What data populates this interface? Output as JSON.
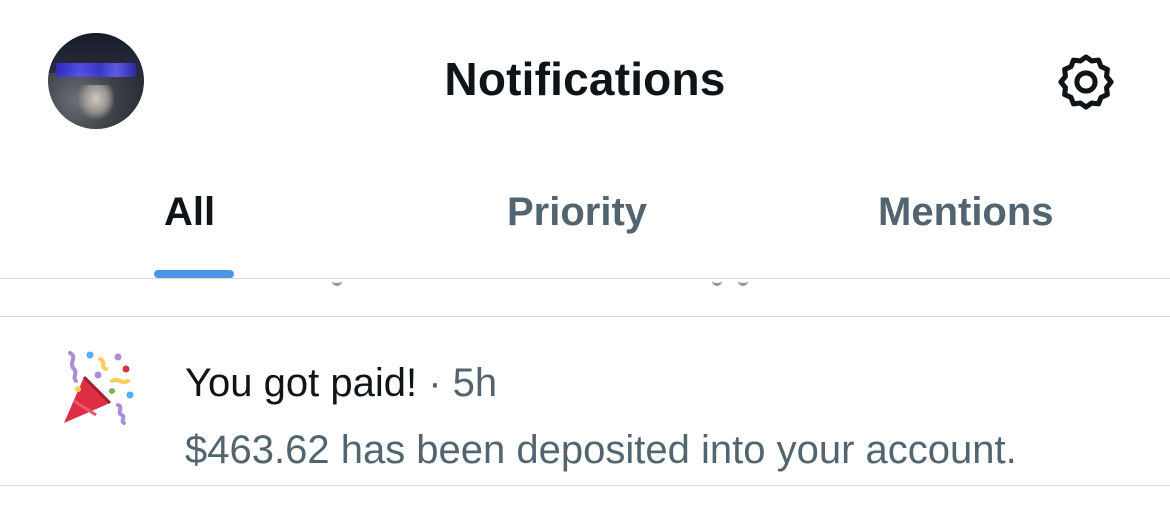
{
  "header": {
    "title": "Notifications",
    "avatar_icon": "profile-photo",
    "settings_icon": "gear-icon"
  },
  "tabs": [
    {
      "label": "All",
      "active": true
    },
    {
      "label": "Priority",
      "active": false
    },
    {
      "label": "Mentions",
      "active": false
    }
  ],
  "notifications": [
    {
      "icon": "party-popper-icon",
      "title": "You got paid!",
      "separator": "·",
      "time": "5h",
      "body": "$463.62 has been deposited into your account."
    }
  ],
  "colors": {
    "accent": "#4a95e6",
    "text_primary": "#0f1419",
    "text_secondary": "#536471",
    "divider": "#d6dadd"
  }
}
